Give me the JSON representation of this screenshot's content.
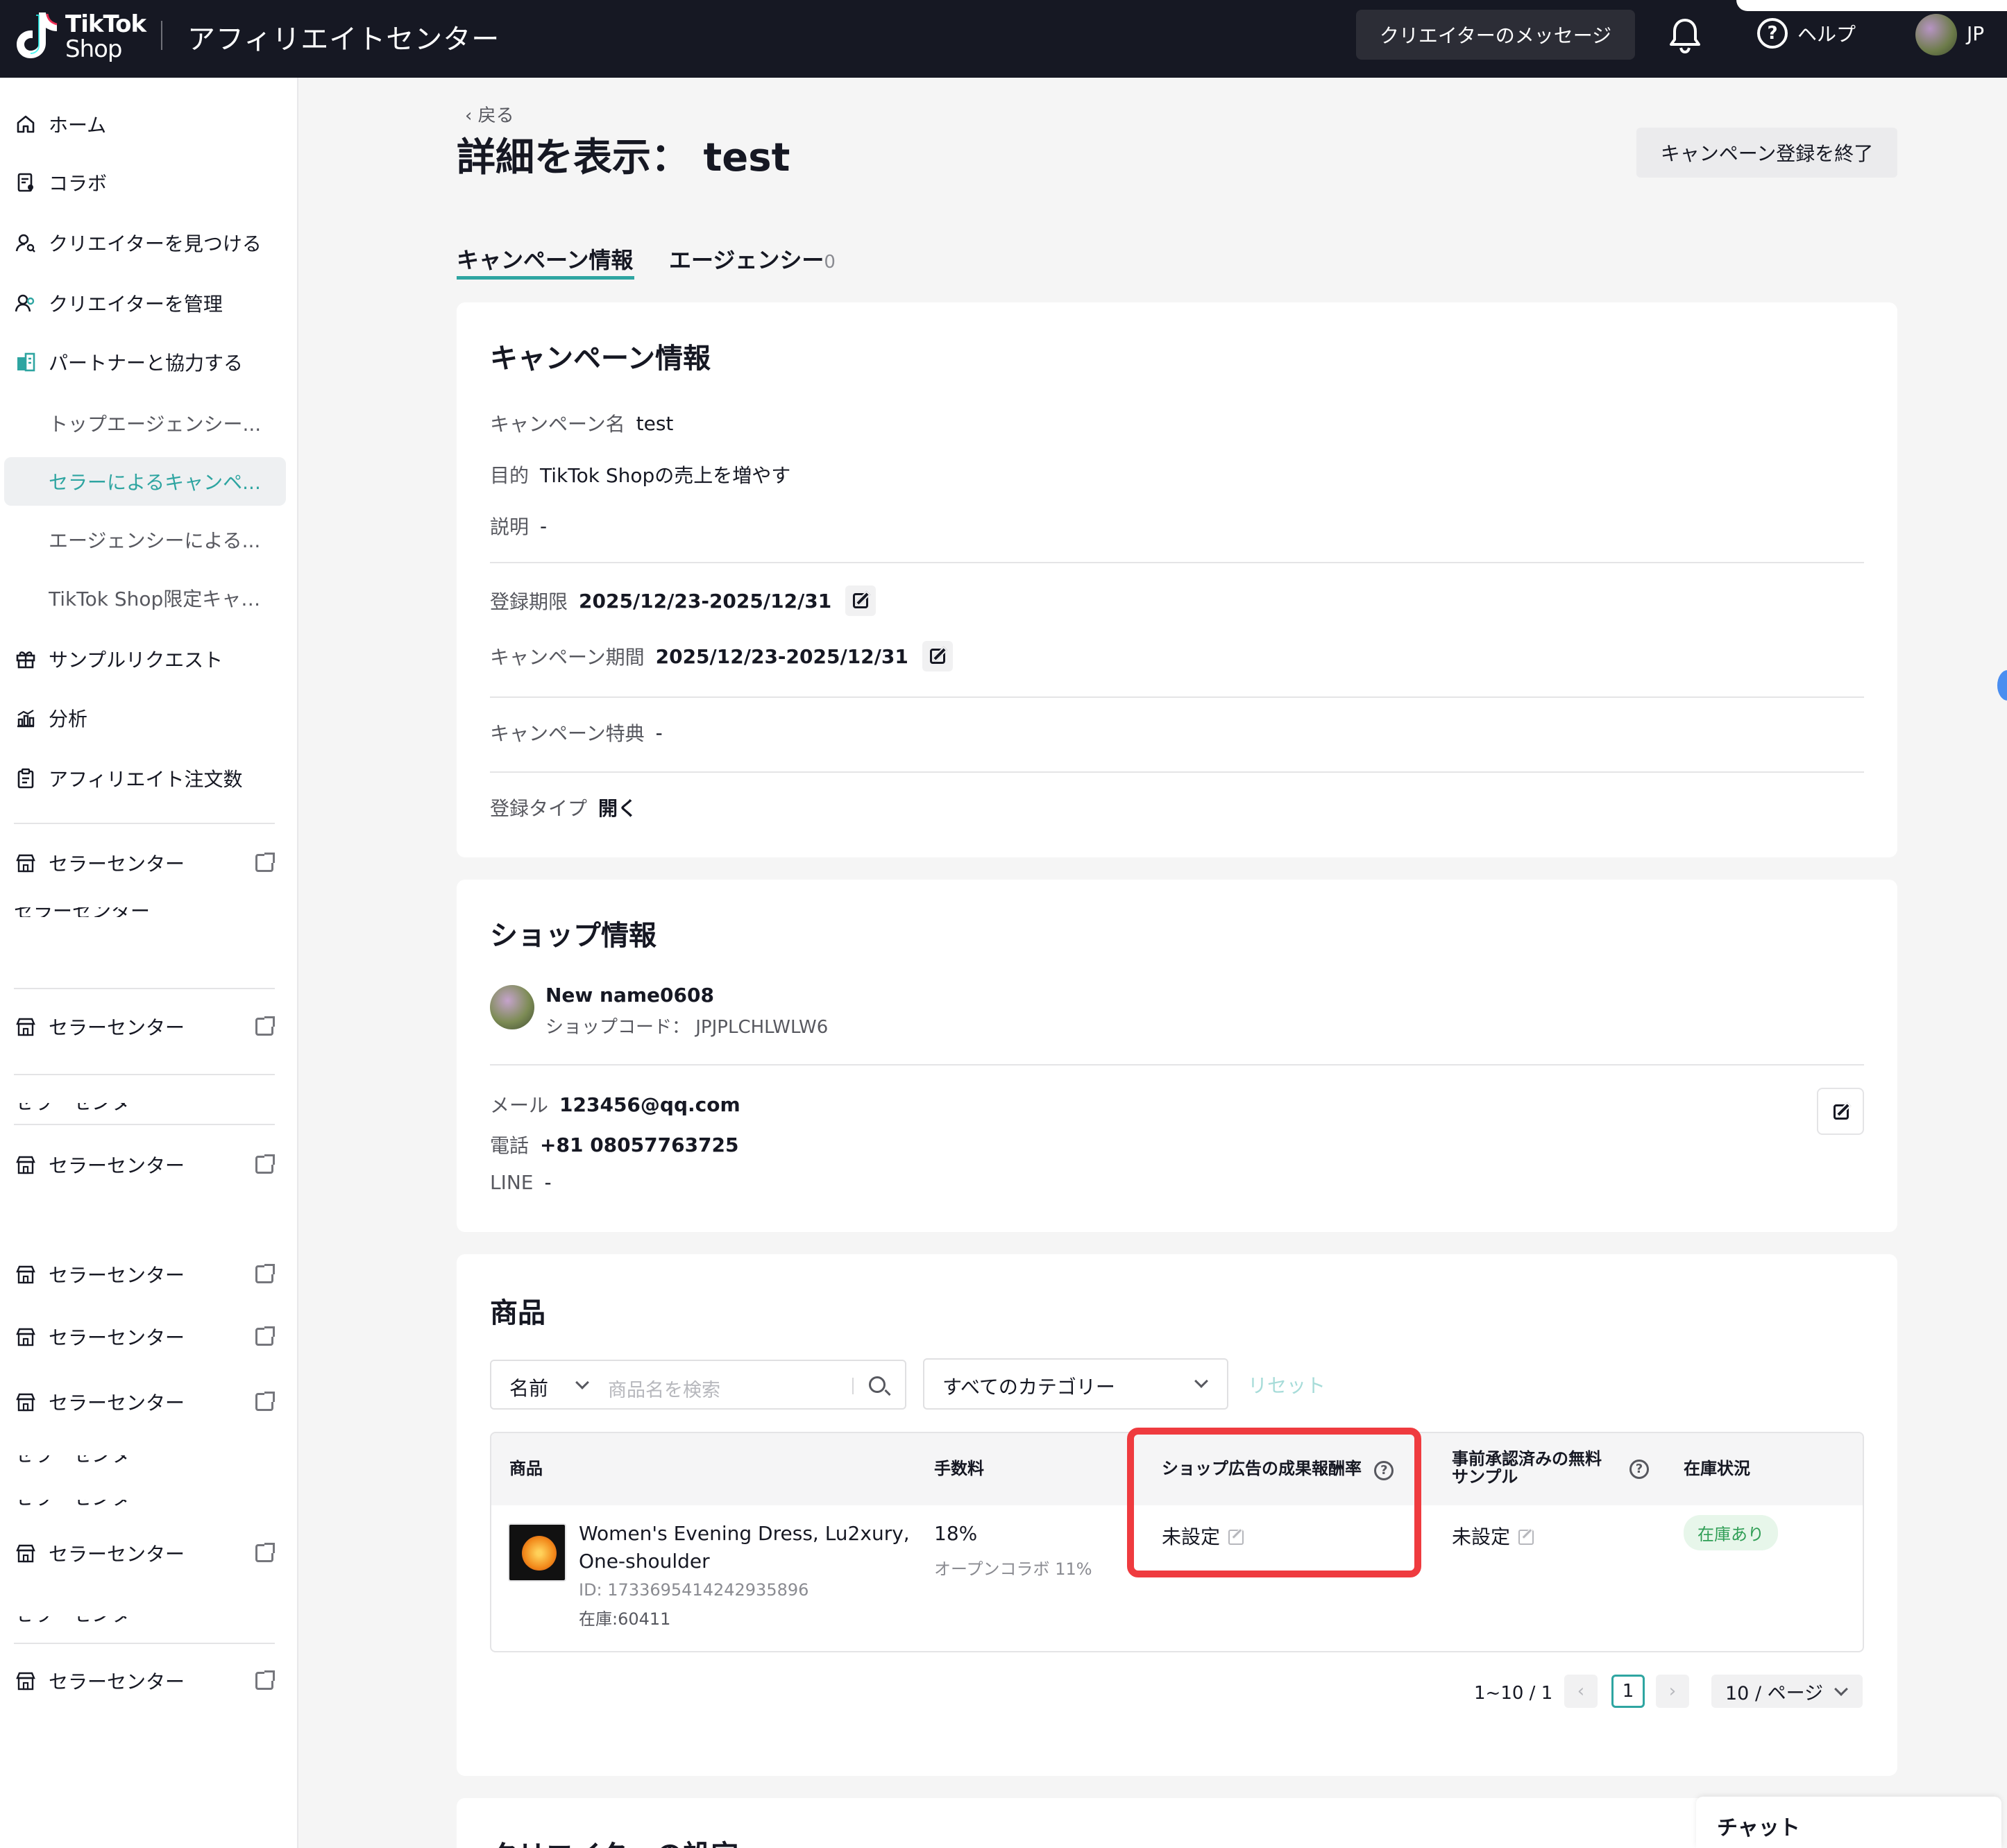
{
  "header": {
    "logo_line1": "TikTok",
    "logo_line2": "Shop",
    "app_title": "アフィリエイトセンター",
    "creator_messages": "クリエイターのメッセージ",
    "help": "ヘルプ",
    "region": "JP"
  },
  "sidebar": {
    "items": [
      {
        "label": "ホーム",
        "icon": "home-icon"
      },
      {
        "label": "コラボ",
        "icon": "collab-icon"
      },
      {
        "label": "クリエイターを見つける",
        "icon": "find-creator-icon"
      },
      {
        "label": "クリエイターを管理",
        "icon": "manage-creator-icon"
      },
      {
        "label": "パートナーと協力する",
        "icon": "partner-icon"
      },
      {
        "label": "トップエージェンシー..."
      },
      {
        "label": "セラーによるキャンペ..."
      },
      {
        "label": "エージェンシーによる..."
      },
      {
        "label": "TikTok Shop限定キャン..."
      },
      {
        "label": "サンプルリクエスト",
        "icon": "gift-icon"
      },
      {
        "label": "分析",
        "icon": "analytics-icon"
      },
      {
        "label": "アフィリエイト注文数",
        "icon": "clipboard-icon"
      }
    ],
    "seller_center": "セラーセンター",
    "seller_center_clipped": "セラーセンター"
  },
  "page": {
    "back": "戻る",
    "title": "詳細を表示：  test",
    "end_button": "キャンペーン登録を終了",
    "tabs": [
      {
        "label": "キャンペーン情報",
        "count": ""
      },
      {
        "label": "エージェンシー",
        "count": "0"
      }
    ]
  },
  "campaign": {
    "title": "キャンペーン情報",
    "name_label": "キャンペーン名",
    "name": "test",
    "purpose_label": "目的",
    "purpose": "TikTok Shopの売上を増やす",
    "desc_label": "説明",
    "desc": "-",
    "reg_period_label": "登録期限",
    "reg_period": "2025/12/23-2025/12/31",
    "camp_period_label": "キャンペーン期間",
    "camp_period": "2025/12/23-2025/12/31",
    "benefit_label": "キャンペーン特典",
    "benefit": "-",
    "reg_type_label": "登録タイプ",
    "reg_type": "開く"
  },
  "shop": {
    "title": "ショップ情報",
    "name": "New name0608",
    "code": "ショップコード：  JPJPLCHLWLW6",
    "mail_label": "メール",
    "mail": "123456@qq.com",
    "phone_label": "電話",
    "phone": "+81 08057763725",
    "line_label": "LINE",
    "line": "-"
  },
  "products": {
    "title": "商品",
    "search_field": "名前",
    "search_placeholder": "商品名を検索",
    "category": "すべてのカテゴリー",
    "reset": "リセット",
    "columns": [
      "商品",
      "手数料",
      "ショップ広告の成果報酬率",
      "事前承認済みの無料",
      "サンプル",
      "在庫状況"
    ],
    "rows": [
      {
        "name_line1": "Women's Evening Dress, Lu2xury,",
        "name_line2": "One-shoulder",
        "id": "ID: 1733695414242935896",
        "stock": "在庫:60411",
        "commission": "18%",
        "open_collab": "オープンコラボ 11%",
        "ad_rate": "未設定",
        "free_sample": "未設定",
        "status": "在庫あり"
      }
    ],
    "pagination": {
      "info": "1~10 / 1",
      "current": "1",
      "page_size": "10 / ページ"
    }
  },
  "next_section_title": "クリエイターの設定",
  "chat": "チャット",
  "colors": {
    "accent": "#2ea5a1",
    "topbar": "#161823",
    "highlight": "#ef3b3f",
    "instock": "#2f9e55"
  }
}
